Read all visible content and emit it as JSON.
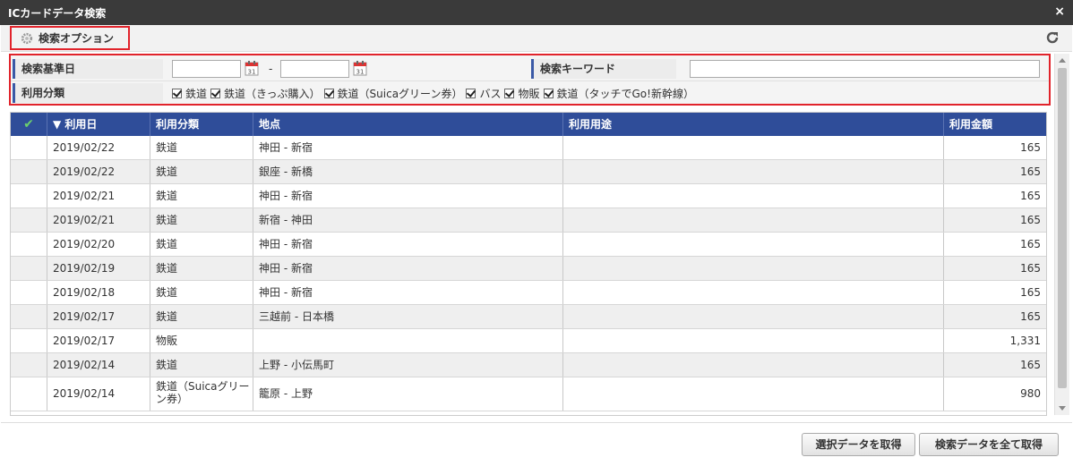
{
  "window": {
    "title": "ICカードデータ検索",
    "close": "×"
  },
  "options": {
    "label": "検索オプション"
  },
  "search": {
    "base_date_label": "検索基準日",
    "date_separator": "-",
    "keyword_label": "検索キーワード",
    "category_label": "利用分類",
    "categories": [
      "鉄道",
      "鉄道（きっぷ購入）",
      "鉄道（Suicaグリーン券）",
      "バス",
      "物販",
      "鉄道（タッチでGo!新幹線）"
    ]
  },
  "grid": {
    "headers": {
      "date": "▼ 利用日",
      "category": "利用分類",
      "location": "地点",
      "purpose": "利用用途",
      "amount": "利用金額"
    },
    "rows": [
      {
        "date": "2019/02/22",
        "category": "鉄道",
        "location": "神田 - 新宿",
        "purpose": "",
        "amount": "165"
      },
      {
        "date": "2019/02/22",
        "category": "鉄道",
        "location": "銀座 - 新橋",
        "purpose": "",
        "amount": "165"
      },
      {
        "date": "2019/02/21",
        "category": "鉄道",
        "location": "神田 - 新宿",
        "purpose": "",
        "amount": "165"
      },
      {
        "date": "2019/02/21",
        "category": "鉄道",
        "location": "新宿 - 神田",
        "purpose": "",
        "amount": "165"
      },
      {
        "date": "2019/02/20",
        "category": "鉄道",
        "location": "神田 - 新宿",
        "purpose": "",
        "amount": "165"
      },
      {
        "date": "2019/02/19",
        "category": "鉄道",
        "location": "神田 - 新宿",
        "purpose": "",
        "amount": "165"
      },
      {
        "date": "2019/02/18",
        "category": "鉄道",
        "location": "神田 - 新宿",
        "purpose": "",
        "amount": "165"
      },
      {
        "date": "2019/02/17",
        "category": "鉄道",
        "location": "三越前 - 日本橋",
        "purpose": "",
        "amount": "165"
      },
      {
        "date": "2019/02/17",
        "category": "物販",
        "location": "",
        "purpose": "",
        "amount": "1,331"
      },
      {
        "date": "2019/02/14",
        "category": "鉄道",
        "location": "上野 - 小伝馬町",
        "purpose": "",
        "amount": "165"
      },
      {
        "date": "2019/02/14",
        "category": "鉄道（Suicaグリーン券）",
        "location": "籠原 - 上野",
        "purpose": "",
        "amount": "980"
      }
    ]
  },
  "buttons": {
    "get_selected": "選択データを取得",
    "get_all": "検索データを全て取得"
  },
  "colors": {
    "accent": "#2f4d99",
    "highlight": "#e1232b",
    "titlebar": "#3a3a3a"
  }
}
